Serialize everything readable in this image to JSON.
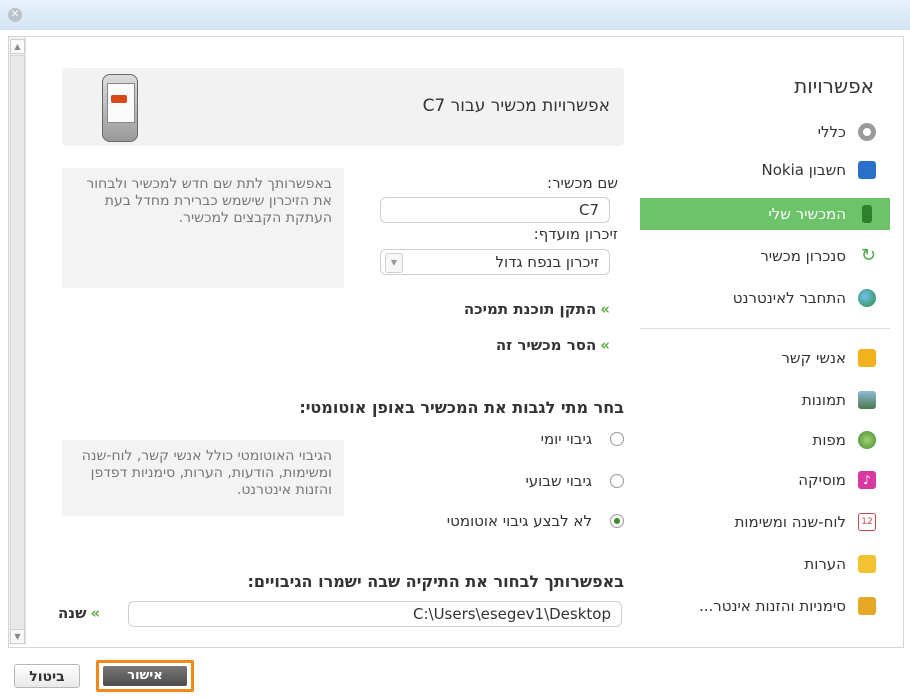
{
  "sidebar": {
    "title": "אפשרויות",
    "items": [
      {
        "label": "כללי",
        "icon": "gear-icon",
        "color": "#9a9a9a"
      },
      {
        "label": "חשבון Nokia",
        "icon": "user-account-icon",
        "color": "#2a6fc9"
      },
      {
        "label": "המכשיר שלי",
        "icon": "phone-icon",
        "color": "#3f8f3a",
        "active": true
      },
      {
        "label": "סנכרון מכשיר",
        "icon": "sync-icon",
        "color": "#4aa84a"
      },
      {
        "label": "התחבר לאינטרנט",
        "icon": "globe-icon",
        "color": "#3a8f3a"
      },
      {
        "label": "אנשי קשר",
        "icon": "contacts-icon",
        "color": "#f1b21c"
      },
      {
        "label": "תמונות",
        "icon": "photos-icon",
        "color": "#6a8fb0"
      },
      {
        "label": "מפות",
        "icon": "maps-icon",
        "color": "#5aa84a"
      },
      {
        "label": "מוסיקה",
        "icon": "music-icon",
        "color": "#d63aa0"
      },
      {
        "label": "לוח-שנה ומשימות",
        "icon": "calendar-icon",
        "color": "#c84a4a"
      },
      {
        "label": "הערות",
        "icon": "notes-icon",
        "color": "#f1c232"
      },
      {
        "label": "סימניות והזנות אינטר...",
        "icon": "bookmarks-icon",
        "color": "#e5a824"
      }
    ]
  },
  "device": {
    "title": "אפשרויות מכשיר עבור C7"
  },
  "name_section": {
    "name_label": "שם מכשיר:",
    "name_value": "C7",
    "memory_label": "זיכרון מועדף:",
    "memory_value": "זיכרון בנפח גדול",
    "info": "באפשרותך לתת שם חדש למכשיר ולבחור את הזיכרון שישמש כברירת מחדל בעת העתקת הקבצים למכשיר."
  },
  "links": {
    "install_support": "התקן תוכנת תמיכה",
    "remove_device": "הסר מכשיר זה"
  },
  "backup": {
    "title": "בחר מתי לגבות את המכשיר באופן אוטומטי:",
    "options": [
      "גיבוי יומי",
      "גיבוי שבועי",
      "לא לבצע גיבוי אוטומטי"
    ],
    "selected_index": 2,
    "info": "הגיבוי האוטומטי כולל אנשי קשר, לוח-שנה ומשימות, הודעות, הערות, סימניות דפדפן והזנות אינטרנט."
  },
  "folder": {
    "title": "באפשרותך לבחור את התיקיה שבה ישמרו הגיבויים:",
    "path": "C:\\Users\\esegev1\\Desktop",
    "change_link": "שנה"
  },
  "buttons": {
    "ok": "אישור",
    "cancel": "ביטול"
  }
}
